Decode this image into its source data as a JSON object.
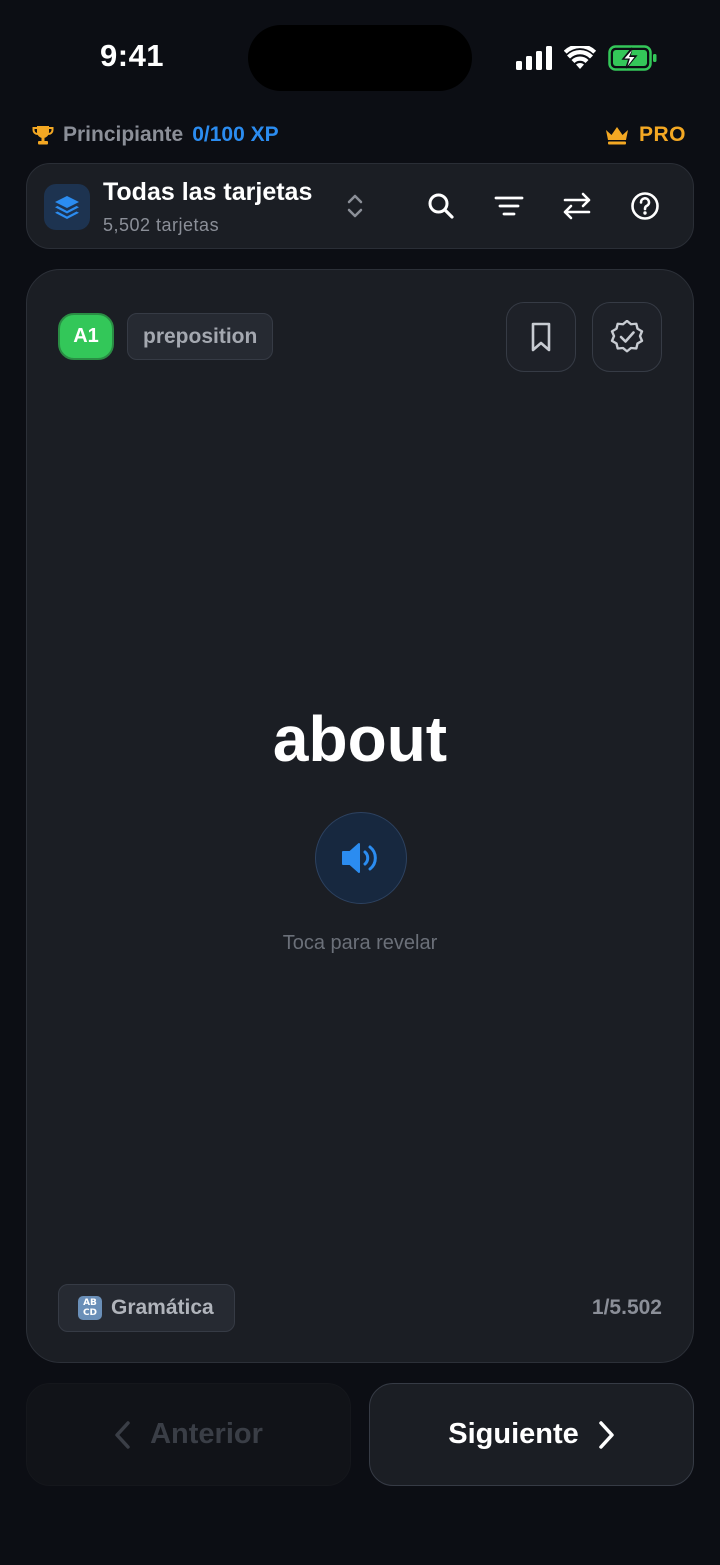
{
  "status_bar": {
    "time": "9:41"
  },
  "progress": {
    "level": "Principiante",
    "xp": "0/100 XP",
    "pro_label": "PRO",
    "icons": [
      "trophy-icon",
      "crown-icon"
    ]
  },
  "deck": {
    "title": "Todas las tarjetas",
    "subtitle": "5,502 tarjetas",
    "toolbar_icons": [
      "search-icon",
      "filter-icon",
      "swap-icon",
      "help-icon"
    ]
  },
  "card": {
    "level": "A1",
    "part_of_speech": "preposition",
    "word": "about",
    "hint": "Toca para revelar",
    "category": "Gramática",
    "category_icon": "🔠",
    "counter": "1/5.502"
  },
  "navigation": {
    "prev_label": "Anterior",
    "next_label": "Siguiente"
  },
  "colors": {
    "accent": "#2b8cf0",
    "pro": "#f4a823",
    "level_green": "#33c759",
    "background": "#0c0e14"
  }
}
